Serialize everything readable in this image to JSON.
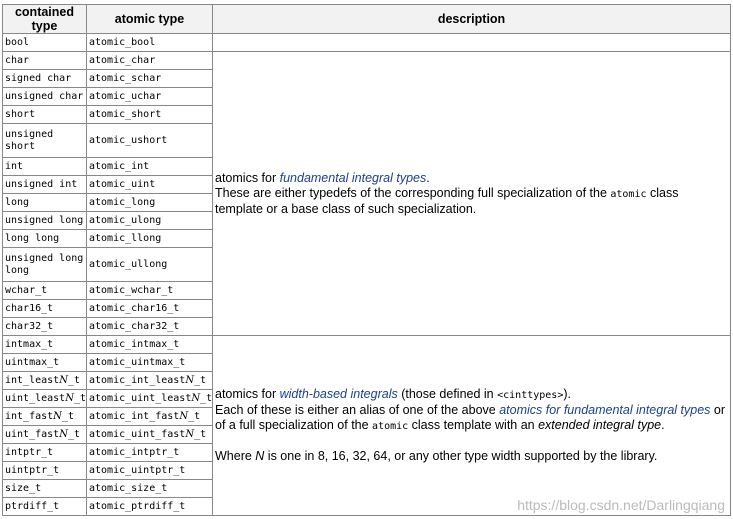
{
  "headers": {
    "contained": "contained type",
    "atomic": "atomic type",
    "description": "description"
  },
  "rows": [
    {
      "contained": "bool",
      "atomic": "atomic_bool"
    },
    {
      "contained": "char",
      "atomic": "atomic_char"
    },
    {
      "contained": "signed char",
      "atomic": "atomic_schar"
    },
    {
      "contained": "unsigned char",
      "atomic": "atomic_uchar"
    },
    {
      "contained": "short",
      "atomic": "atomic_short"
    },
    {
      "contained": "unsigned short",
      "atomic": "atomic_ushort"
    },
    {
      "contained": "int",
      "atomic": "atomic_int"
    },
    {
      "contained": "unsigned int",
      "atomic": "atomic_uint"
    },
    {
      "contained": "long",
      "atomic": "atomic_long"
    },
    {
      "contained": "unsigned long",
      "atomic": "atomic_ulong"
    },
    {
      "contained": "long long",
      "atomic": "atomic_llong"
    },
    {
      "contained": "unsigned long long",
      "atomic": "atomic_ullong"
    },
    {
      "contained": "wchar_t",
      "atomic": "atomic_wchar_t"
    },
    {
      "contained": "char16_t",
      "atomic": "atomic_char16_t"
    },
    {
      "contained": "char32_t",
      "atomic": "atomic_char32_t"
    },
    {
      "contained": "intmax_t",
      "atomic": "atomic_intmax_t"
    },
    {
      "contained": "uintmax_t",
      "atomic": "atomic_uintmax_t"
    },
    {
      "contained": "int_leastN_t",
      "atomic": "atomic_int_leastN_t"
    },
    {
      "contained": "uint_leastN_t",
      "atomic": "atomic_uint_leastN_t"
    },
    {
      "contained": "int_fastN_t",
      "atomic": "atomic_int_fastN_t"
    },
    {
      "contained": "uint_fastN_t",
      "atomic": "atomic_uint_fastN_t"
    },
    {
      "contained": "intptr_t",
      "atomic": "atomic_intptr_t"
    },
    {
      "contained": "uintptr_t",
      "atomic": "atomic_uintptr_t"
    },
    {
      "contained": "size_t",
      "atomic": "atomic_size_t"
    },
    {
      "contained": "ptrdiff_t",
      "atomic": "atomic_ptrdiff_t"
    }
  ],
  "desc_fundamental": {
    "p1_prefix": "atomics for ",
    "p1_link": "fundamental integral types",
    "p1_suffix": ".",
    "p2_a": "These are either typedefs of the corresponding full specialization of the ",
    "p2_code": "atomic",
    "p2_b": " class template or a base class of such specialization."
  },
  "desc_width": {
    "p1_prefix": "atomics for ",
    "p1_link": "width-based integrals",
    "p1_suffix": " (those defined in ",
    "p1_code": "<cinttypes>",
    "p1_end": ").",
    "p2_a": "Each of these is either an alias of one of the above ",
    "p2_link": "atomics for fundamental integral types",
    "p2_b": " or of a full specialization of the ",
    "p2_code": "atomic",
    "p2_c": " class template with an ",
    "p2_it": "extended integral type",
    "p2_d": ".",
    "p3_a": "Where ",
    "p3_n": "N",
    "p3_b": " is one in 8, 16, 32, 64, or any other type width supported by the library."
  },
  "watermark": "https://blog.csdn.net/Darlingqiang",
  "colors": {
    "link": "#1e3f8f",
    "border": "#888888",
    "header_bg": "#f2f2f2"
  }
}
